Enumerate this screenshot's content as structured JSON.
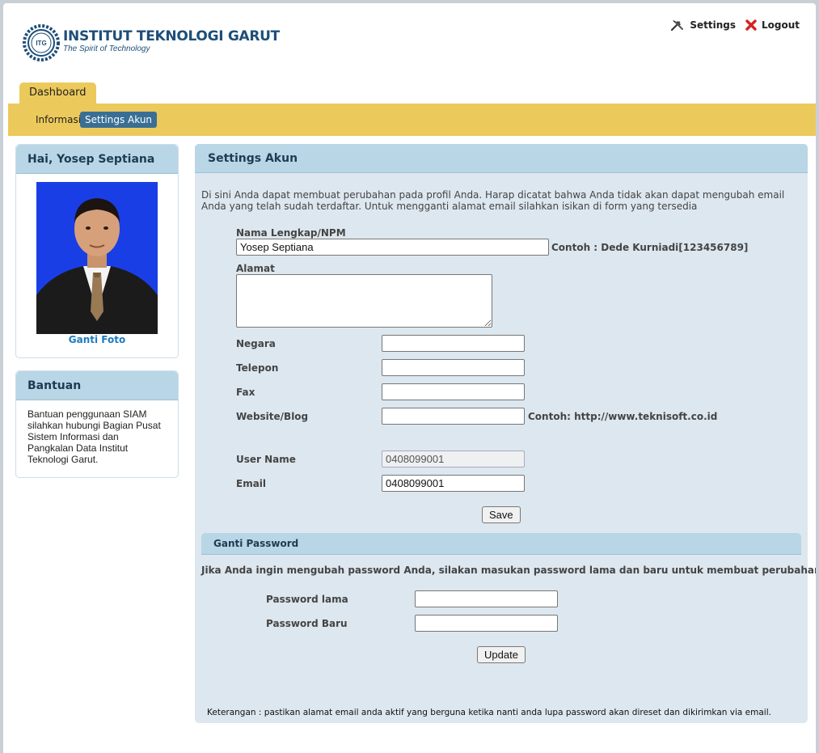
{
  "header": {
    "title": "INSTITUT TEKNOLOGI GARUT",
    "subtitle": "The Spirit of Technology",
    "logo_text": "ITG",
    "settings_label": "Settings",
    "logout_label": "Logout"
  },
  "nav": {
    "tab": "Dashboard",
    "items": [
      {
        "label": "Informasi",
        "active": false
      },
      {
        "label": "Settings Akun",
        "active": true
      }
    ]
  },
  "sidebar": {
    "greeting": "Hai, Yosep Septiana",
    "photo_link": "Ganti Foto",
    "help_title": "Bantuan",
    "help_text": "Bantuan penggunaan SIAM silahkan hubungi Bagian Pusat Sistem Informasi dan Pangkalan Data Institut Teknologi Garut."
  },
  "main": {
    "title": "Settings Akun",
    "intro": "Di sini Anda dapat membuat perubahan pada profil Anda. Harap dicatat bahwa Anda tidak akan dapat mengubah email Anda yang telah sudah terdaftar. Untuk mengganti alamat email silahkan isikan di form yang tersedia",
    "form": {
      "nama_label": "Nama Lengkap/NPM",
      "nama_value": "Yosep Septiana",
      "nama_hint": "Contoh : Dede Kurniadi[123456789]",
      "alamat_label": "Alamat",
      "alamat_value": "",
      "negara_label": "Negara",
      "negara_value": "",
      "telepon_label": "Telepon",
      "telepon_value": "",
      "fax_label": "Fax",
      "fax_value": "",
      "website_label": "Website/Blog",
      "website_value": "",
      "website_hint": "Contoh: http://www.teknisoft.co.id",
      "username_label": "User Name",
      "username_value": "0408099001",
      "email_label": "Email",
      "email_value": "0408099001",
      "save_label": "Save"
    },
    "password": {
      "title": "Ganti Password",
      "intro": "Jika Anda ingin mengubah password Anda, silakan masukan password lama dan baru untuk membuat perubahan.",
      "old_label": "Password lama",
      "old_value": "",
      "new_label": "Password Baru",
      "new_value": "",
      "update_label": "Update"
    },
    "note": "Keterangan : pastikan alamat email anda aktif yang berguna ketika nanti anda lupa password akan direset dan dikirimkan via email."
  },
  "colors": {
    "nav_yellow": "#ecc95b",
    "active_tab": "#3a6f95",
    "panel_head": "#b8d6e6",
    "panel_body": "#dde7ef",
    "brand_blue": "#1d4e79",
    "link_blue": "#1b7bbf"
  }
}
